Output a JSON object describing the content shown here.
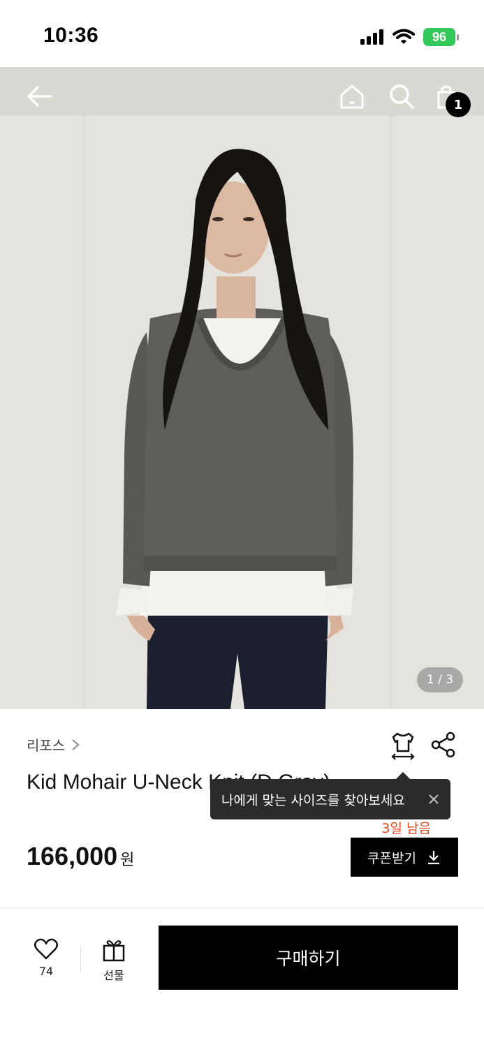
{
  "status_bar": {
    "time": "10:36",
    "battery": "96"
  },
  "hero": {
    "pager": "1 / 3"
  },
  "nav": {
    "cart_count": "1"
  },
  "product": {
    "brand": "리포스",
    "name": "Kid Mohair U-Neck Knit (D.Gray)",
    "price": "166,000",
    "currency": "원",
    "days_left": "3일 남음",
    "coupon_label": "쿠폰받기"
  },
  "tooltip": {
    "text": "나에게 맞는 사이즈를 찾아보세요"
  },
  "bottom_bar": {
    "like_count": "74",
    "gift_label": "선물",
    "buy_label": "구매하기"
  },
  "colors": {
    "accent": "#000000",
    "days_left": "#e04a1f",
    "battery": "#34c759"
  }
}
